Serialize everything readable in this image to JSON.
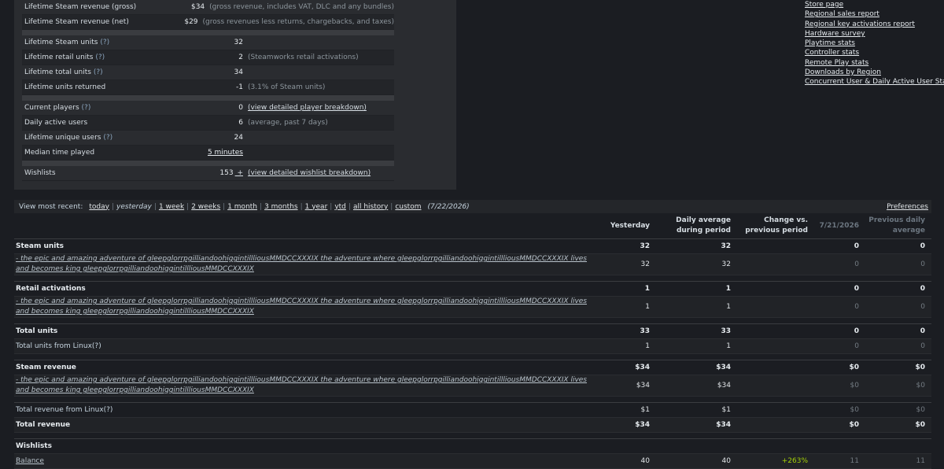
{
  "summary": [
    {
      "label": "Lifetime Steam revenue (gross)",
      "q": "",
      "value": "$34",
      "note": "(gross revenue, includes VAT, DLC and any bundles)",
      "note_link": false,
      "value_link": false
    },
    {
      "label": "Lifetime Steam revenue (net)",
      "q": "",
      "value": "$29",
      "note": "(gross revenues less returns, chargebacks, and taxes)",
      "note_link": false,
      "value_link": false
    },
    {
      "gap": true
    },
    {
      "label": "Lifetime Steam units",
      "q": "(?)",
      "value": "32",
      "note": "",
      "note_link": false,
      "value_link": false
    },
    {
      "label": "Lifetime retail units",
      "q": "(?)",
      "value": "2",
      "note": "(Steamworks retail activations)",
      "note_link": false,
      "value_link": false
    },
    {
      "label": "Lifetime total units",
      "q": "(?)",
      "value": "34",
      "note": "",
      "note_link": false,
      "value_link": false
    },
    {
      "label": "Lifetime units returned",
      "q": "",
      "value": "-1",
      "note": "(3.1% of Steam units)",
      "note_link": false,
      "value_link": false
    },
    {
      "gap": true
    },
    {
      "label": "Current players",
      "q": "(?)",
      "value": "0",
      "note": "(view detailed player breakdown)",
      "note_link": true,
      "value_link": false
    },
    {
      "label": "Daily active users",
      "q": "",
      "value": "6",
      "note": "(average, past 7 days)",
      "note_link": false,
      "value_link": false
    },
    {
      "label": "Lifetime unique users",
      "q": "(?)",
      "value": "24",
      "note": "",
      "note_link": false,
      "value_link": false
    },
    {
      "label": "Median time played",
      "q": "",
      "value": "5 minutes",
      "note": "",
      "note_link": false,
      "value_link": true
    },
    {
      "gap": true
    },
    {
      "label": "Wishlists",
      "q": "",
      "value": "153",
      "plus": "+",
      "note": "(view detailed wishlist breakdown)",
      "note_link": true,
      "value_link": false
    }
  ],
  "right_links": [
    "Store page",
    "Regional sales report",
    "Regional key activations report",
    "Hardware survey",
    "Playtime stats",
    "Controller stats",
    "Remote Play stats",
    "Downloads by Region",
    "Concurrent User & Daily Active User Stats"
  ],
  "range": {
    "label": "View most recent:",
    "options": [
      {
        "text": "today",
        "current": false
      },
      {
        "text": "yesterday",
        "current": true
      },
      {
        "text": "1 week",
        "current": false
      },
      {
        "text": "2 weeks",
        "current": false
      },
      {
        "text": "1 month",
        "current": false
      },
      {
        "text": "3 months",
        "current": false
      },
      {
        "text": "1 year",
        "current": false
      },
      {
        "text": "ytd",
        "current": false
      },
      {
        "text": "all history",
        "current": false
      },
      {
        "text": "custom",
        "current": false
      }
    ],
    "date": "(7/22/2026)",
    "preferences": "Preferences"
  },
  "table": {
    "headers": [
      {
        "text": "Yesterday",
        "dim": false
      },
      {
        "text": "Daily average during period",
        "dim": false
      },
      {
        "text": "Change vs. previous period",
        "dim": false
      },
      {
        "text": "7/21/2026",
        "dim": true
      },
      {
        "text": "Previous daily average",
        "dim": true
      }
    ],
    "rows": [
      {
        "type": "bold",
        "label": "Steam units",
        "v": [
          "32",
          "32",
          "",
          "0",
          "0"
        ]
      },
      {
        "type": "sub",
        "label": "the epic and amazing adventure of gleepglorrpgilliandoohiggintillliousMMDCCXXXIX the adventure where gleepglorrpgilliandoohiggintillliousMMDCCXXXIX lives and becomes king gleepglorrpgilliandoohiggintillliousMMDCCXXXIX",
        "v": [
          "32",
          "32",
          "",
          "0",
          "0"
        ]
      },
      {
        "type": "spacer"
      },
      {
        "type": "bold",
        "label": "Retail activations",
        "v": [
          "1",
          "1",
          "",
          "0",
          "0"
        ]
      },
      {
        "type": "sub",
        "label": "the epic and amazing adventure of gleepglorrpgilliandoohiggintillliousMMDCCXXXIX the adventure where gleepglorrpgilliandoohiggintillliousMMDCCXXXIX lives and becomes king gleepglorrpgilliandoohiggintillliousMMDCCXXXIX",
        "v": [
          "1",
          "1",
          "",
          "0",
          "0"
        ]
      },
      {
        "type": "spacer"
      },
      {
        "type": "bold",
        "label": "Total units",
        "v": [
          "33",
          "33",
          "",
          "0",
          "0"
        ]
      },
      {
        "type": "plain",
        "label": "Total units from Linux(?)",
        "v": [
          "1",
          "1",
          "",
          "0",
          "0"
        ]
      },
      {
        "type": "spacer"
      },
      {
        "type": "bold",
        "label": "Steam revenue",
        "v": [
          "$34",
          "$34",
          "",
          "$0",
          "$0"
        ]
      },
      {
        "type": "sub",
        "label": "the epic and amazing adventure of gleepglorrpgilliandoohiggintillliousMMDCCXXXIX the adventure where gleepglorrpgilliandoohiggintillliousMMDCCXXXIX lives and becomes king gleepglorrpgilliandoohiggintillliousMMDCCXXXIX",
        "v": [
          "$34",
          "$34",
          "",
          "$0",
          "$0"
        ]
      },
      {
        "type": "spacer"
      },
      {
        "type": "plain",
        "label": "Total revenue from Linux(?)",
        "v": [
          "$1",
          "$1",
          "",
          "$0",
          "$0"
        ]
      },
      {
        "type": "bold",
        "label": "Total revenue",
        "v": [
          "$34",
          "$34",
          "",
          "$0",
          "$0"
        ]
      },
      {
        "type": "spacer"
      },
      {
        "type": "section",
        "label": "Wishlists",
        "v": [
          "",
          "",
          "",
          "",
          ""
        ]
      },
      {
        "type": "link",
        "label": "Balance",
        "v": [
          "40",
          "40",
          "+263%",
          "11",
          "11"
        ]
      }
    ]
  }
}
